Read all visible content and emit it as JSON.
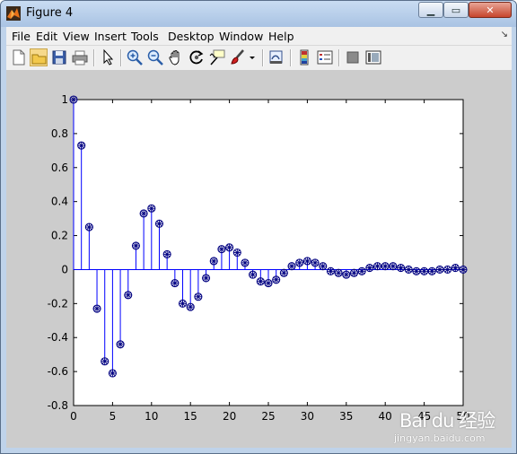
{
  "window": {
    "title": "Figure 4",
    "minimize_symbol": "▁",
    "maximize_symbol": "▭",
    "close_symbol": "✕"
  },
  "menu": {
    "items": [
      "File",
      "Edit",
      "View",
      "Insert",
      "Tools",
      "Desktop",
      "Window",
      "Help"
    ],
    "corner_arrow": "↘"
  },
  "toolbar": {
    "tools": [
      {
        "name": "new-figure-icon"
      },
      {
        "name": "open-file-icon"
      },
      {
        "name": "save-icon"
      },
      {
        "name": "print-icon"
      },
      {
        "name": "edit-plot-arrow-icon"
      },
      {
        "name": "zoom-in-icon"
      },
      {
        "name": "zoom-out-icon"
      },
      {
        "name": "pan-hand-icon"
      },
      {
        "name": "rotate-3d-icon"
      },
      {
        "name": "data-cursor-icon"
      },
      {
        "name": "brush-icon"
      },
      {
        "name": "brush-dropdown-icon"
      },
      {
        "name": "link-plot-icon"
      },
      {
        "name": "colorbar-icon"
      },
      {
        "name": "legend-icon"
      },
      {
        "name": "hide-plot-tools-icon"
      },
      {
        "name": "show-plot-tools-icon"
      }
    ]
  },
  "colors": {
    "stem": "#0000ff",
    "marker": "#000080",
    "figure_bg": "#cccccc",
    "axes_bg": "#ffffff"
  },
  "chart_data": {
    "type": "stem",
    "title": "",
    "xlabel": "",
    "ylabel": "",
    "xlim": [
      0,
      50
    ],
    "ylim": [
      -0.8,
      1
    ],
    "xticks": [
      0,
      5,
      10,
      15,
      20,
      25,
      30,
      35,
      40,
      45,
      50
    ],
    "xtick_labels": [
      "0",
      "5",
      "10",
      "15",
      "20",
      "25",
      "30",
      "35",
      "40",
      "45",
      "50"
    ],
    "yticks": [
      -0.8,
      -0.6,
      -0.4,
      -0.2,
      0,
      0.2,
      0.4,
      0.6,
      0.8,
      1
    ],
    "ytick_labels": [
      "-0.8",
      "-0.6",
      "-0.4",
      "-0.2",
      "0",
      "0.2",
      "0.4",
      "0.6",
      "0.8",
      "1"
    ],
    "grid": false,
    "marker": "circle-asterisk",
    "series": [
      {
        "x": [
          0,
          1,
          2,
          3,
          4,
          5,
          6,
          7,
          8,
          9,
          10,
          11,
          12,
          13,
          14,
          15,
          16,
          17,
          18,
          19,
          20,
          21,
          22,
          23,
          24,
          25,
          26,
          27,
          28,
          29,
          30,
          31,
          32,
          33,
          34,
          35,
          36,
          37,
          38,
          39,
          40,
          41,
          42,
          43,
          44,
          45,
          46,
          47,
          48,
          49,
          50
        ],
        "values": [
          1.0,
          0.73,
          0.25,
          -0.23,
          -0.54,
          -0.61,
          -0.44,
          -0.15,
          0.14,
          0.33,
          0.36,
          0.27,
          0.09,
          -0.08,
          -0.2,
          -0.22,
          -0.16,
          -0.05,
          0.05,
          0.12,
          0.13,
          0.1,
          0.04,
          -0.03,
          -0.07,
          -0.08,
          -0.06,
          -0.02,
          0.02,
          0.04,
          0.05,
          0.04,
          0.02,
          -0.01,
          -0.02,
          -0.03,
          -0.02,
          -0.01,
          0.01,
          0.02,
          0.02,
          0.02,
          0.01,
          0.0,
          -0.01,
          -0.01,
          -0.01,
          0.0,
          0.0,
          0.01,
          0.0
        ]
      }
    ]
  },
  "watermark": {
    "logo_text": "Bai du 经验",
    "url_text": "jingyan.baidu.com"
  }
}
